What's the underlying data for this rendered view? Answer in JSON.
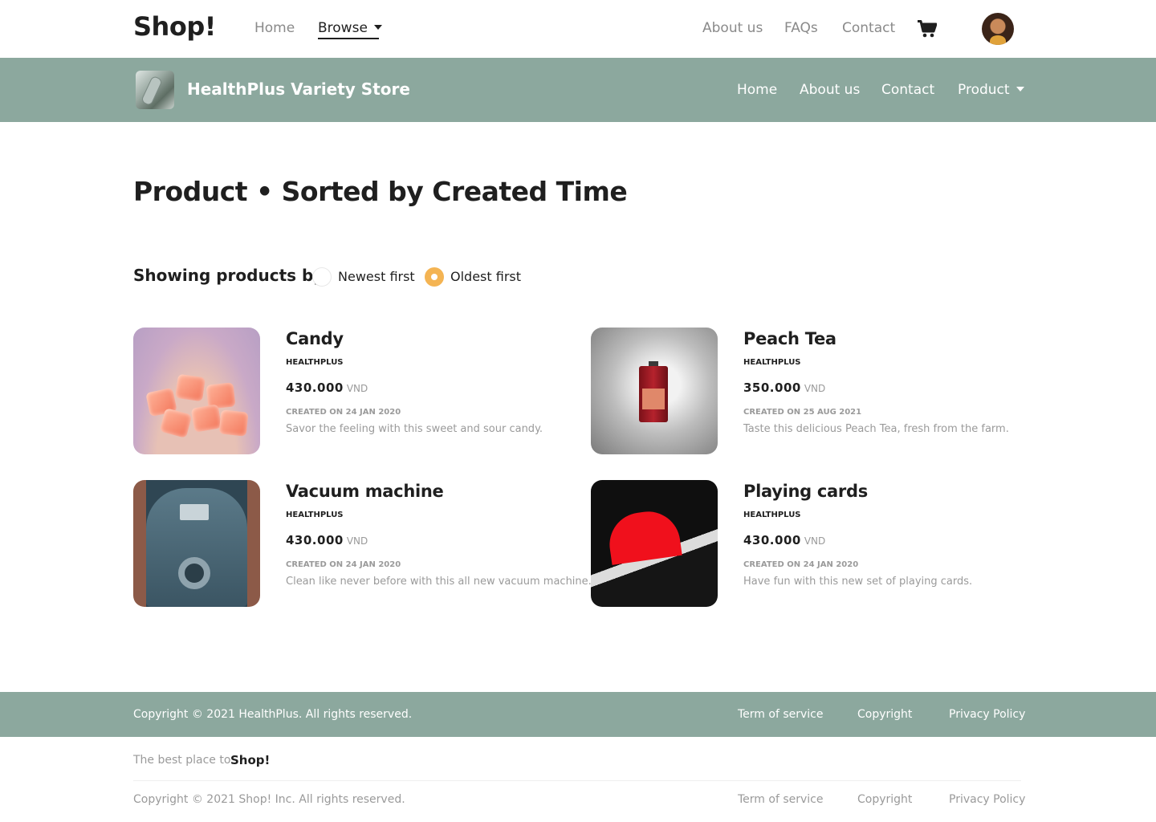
{
  "topnav": {
    "brand": "Shop!",
    "links": [
      "Home",
      "Browse",
      "About us",
      "FAQs",
      "Contact"
    ],
    "active_link": "Browse",
    "cart_icon": "cart-icon",
    "avatar_icon": "user-avatar"
  },
  "store": {
    "name": "HealthPlus Variety Store",
    "links": [
      "Home",
      "About us",
      "Contact",
      "Product"
    ]
  },
  "page": {
    "title": "Product • Sorted by Created Time"
  },
  "sort": {
    "label": "Showing products by",
    "options": [
      "Newest first",
      "Oldest first"
    ],
    "selected": "Oldest first"
  },
  "products": [
    {
      "name": "Candy",
      "brand": "HEALTHPLUS",
      "price": "430.000",
      "currency": "VND",
      "created": "CREATED ON 24 JAN 2020",
      "description": "Savor the feeling with this sweet and sour candy."
    },
    {
      "name": "Peach Tea",
      "brand": "HEALTHPLUS",
      "price": "350.000",
      "currency": "VND",
      "created": "CREATED ON 25 AUG 2021",
      "description": "Taste this delicious Peach Tea, fresh from the farm."
    },
    {
      "name": "Vacuum machine",
      "brand": "HEALTHPLUS",
      "price": "430.000",
      "currency": "VND",
      "created": "CREATED ON 24 JAN 2020",
      "description": "Clean like never before with this all new vacuum machine."
    },
    {
      "name": "Playing cards",
      "brand": "HEALTHPLUS",
      "price": "430.000",
      "currency": "VND",
      "created": "CREATED ON 24 JAN 2020",
      "description": "Have fun with this new set of playing cards."
    }
  ],
  "store_footer": {
    "copyright": "Copyright © 2021 HealthPlus. All rights reserved.",
    "links": [
      "Term of service",
      "Copyright",
      "Privacy Policy"
    ]
  },
  "site_footer": {
    "tagline": "The best place to",
    "brand": "Shop!",
    "copyright": "Copyright © 2021 Shop! Inc. All rights reserved.",
    "links": [
      "Term of service",
      "Copyright",
      "Privacy Policy"
    ]
  },
  "colors": {
    "accent": "#8ca89e",
    "radio_selected": "#f4b453",
    "text_dark": "#1f1f1f",
    "text_muted": "#9a9a9a"
  }
}
